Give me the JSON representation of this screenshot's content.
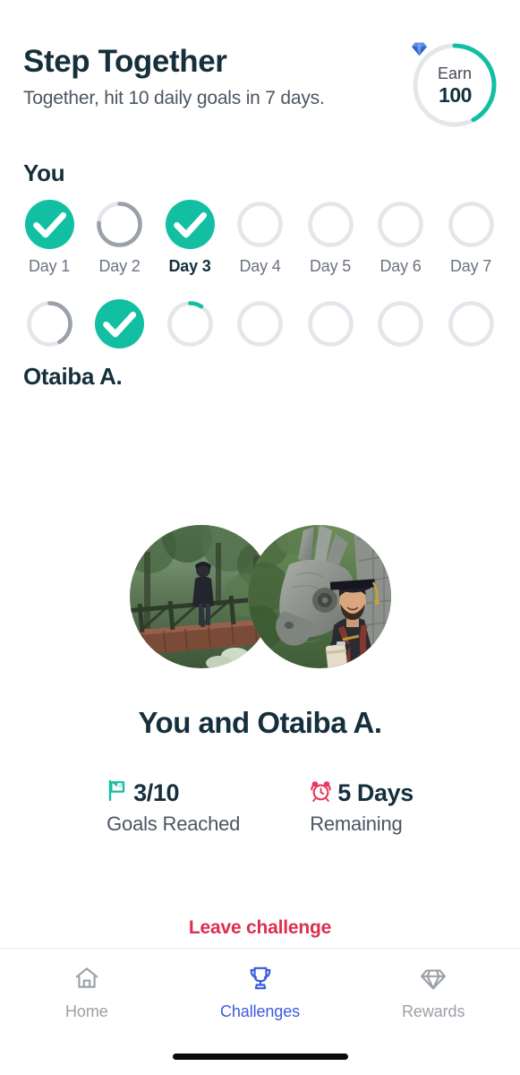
{
  "header": {
    "title": "Step Together",
    "subtitle": "Together, hit 10 daily goals in 7 days.",
    "earn": {
      "label": "Earn",
      "amount": "100",
      "gem_icon": "gem-icon",
      "ring_progress_percent": 42,
      "ring_color": "#12BFA3",
      "ring_track_color": "#E3E6EA"
    }
  },
  "streak": {
    "participants": [
      {
        "name": "You",
        "show_day_labels": true,
        "days": [
          {
            "label": "Day 1",
            "state": "complete",
            "progress": 100,
            "current": false
          },
          {
            "label": "Day 2",
            "state": "partial-gray",
            "progress": 76,
            "current": false
          },
          {
            "label": "Day 3",
            "state": "complete",
            "progress": 100,
            "current": true
          },
          {
            "label": "Day 4",
            "state": "empty",
            "progress": 0,
            "current": false
          },
          {
            "label": "Day 5",
            "state": "empty",
            "progress": 0,
            "current": false
          },
          {
            "label": "Day 6",
            "state": "empty",
            "progress": 0,
            "current": false
          },
          {
            "label": "Day 7",
            "state": "empty",
            "progress": 0,
            "current": false
          }
        ]
      },
      {
        "name": "Otaiba A.",
        "show_day_labels": false,
        "days": [
          {
            "label": "Day 1",
            "state": "partial-gray",
            "progress": 42,
            "current": false
          },
          {
            "label": "Day 2",
            "state": "complete",
            "progress": 100,
            "current": false
          },
          {
            "label": "Day 3",
            "state": "partial-teal",
            "progress": 9,
            "current": true
          },
          {
            "label": "Day 4",
            "state": "empty",
            "progress": 0,
            "current": false
          },
          {
            "label": "Day 5",
            "state": "empty",
            "progress": 0,
            "current": false
          },
          {
            "label": "Day 6",
            "state": "empty",
            "progress": 0,
            "current": false
          },
          {
            "label": "Day 7",
            "state": "empty",
            "progress": 0,
            "current": false
          }
        ]
      }
    ]
  },
  "avatars": {
    "first_alt": "person standing on a wooden forest bridge",
    "second_alt": "graduate in cap and gown beside a stone dragon statue"
  },
  "pair": {
    "title": "You and Otaiba A."
  },
  "stats": [
    {
      "icon": "flag-icon",
      "icon_color": "#12BFA3",
      "value": "3/10",
      "caption": "Goals Reached"
    },
    {
      "icon": "alarm-clock-icon",
      "icon_color": "#E8395A",
      "value": "5 Days",
      "caption": "Remaining"
    }
  ],
  "actions": {
    "leave_label": "Leave challenge",
    "leave_color": "#DC2F4E"
  },
  "bottom_nav": {
    "active_color": "#3B5BDB",
    "inactive_color": "#9AA0A6",
    "items": [
      {
        "label": "Home",
        "icon": "home-icon",
        "active": false
      },
      {
        "label": "Challenges",
        "icon": "trophy-icon",
        "active": true
      },
      {
        "label": "Rewards",
        "icon": "diamond-icon",
        "active": false
      }
    ]
  },
  "colors": {
    "teal": "#12BFA3",
    "ring_track": "#E3E6EA",
    "ring_gray_fill": "#9AA1AC",
    "text_dark": "#15303C",
    "text_muted": "#4B5563"
  }
}
